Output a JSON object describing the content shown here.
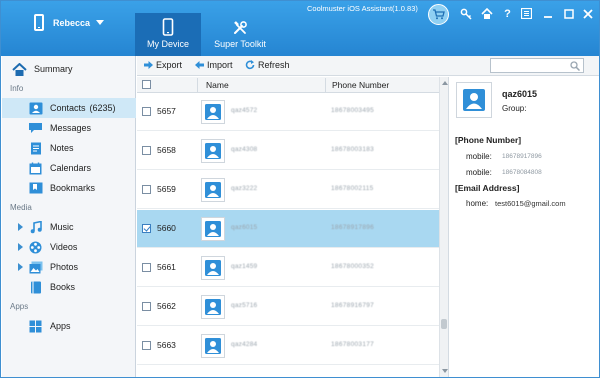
{
  "app": {
    "title": "Coolmuster iOS Assistant(1.0.83)",
    "device_name": "Rebecca"
  },
  "tabs": [
    {
      "label": "My Device"
    },
    {
      "label": "Super Toolkit"
    }
  ],
  "window_controls": {
    "key": "🔑",
    "home": "⌂",
    "help": "?",
    "menu": "▤",
    "minimize": "—",
    "close": "✕"
  },
  "sidebar": {
    "summary": "Summary",
    "section_info": "Info",
    "contacts": "Contacts",
    "contacts_count": "(6235)",
    "messages": "Messages",
    "notes": "Notes",
    "calendars": "Calendars",
    "bookmarks": "Bookmarks",
    "section_media": "Media",
    "music": "Music",
    "videos": "Videos",
    "photos": "Photos",
    "books": "Books",
    "section_apps": "Apps",
    "apps": "Apps"
  },
  "toolbar": {
    "export": "Export",
    "import": "Import",
    "refresh": "Refresh",
    "search_placeholder": ""
  },
  "table": {
    "columns": {
      "name": "Name",
      "phone": "Phone Number"
    },
    "rows": [
      {
        "id": "5657",
        "name": "qaz4572",
        "phone": "18678003495",
        "checked": false
      },
      {
        "id": "5658",
        "name": "qaz4308",
        "phone": "18678003183",
        "checked": false
      },
      {
        "id": "5659",
        "name": "qaz3222",
        "phone": "18678002115",
        "checked": false
      },
      {
        "id": "5660",
        "name": "qaz6015",
        "phone": "18678917896",
        "checked": true
      },
      {
        "id": "5661",
        "name": "qaz1459",
        "phone": "18678000352",
        "checked": false
      },
      {
        "id": "5662",
        "name": "qaz5716",
        "phone": "18678916797",
        "checked": false
      },
      {
        "id": "5663",
        "name": "qaz4284",
        "phone": "18678003177",
        "checked": false
      }
    ]
  },
  "detail": {
    "name": "qaz6015",
    "group_label": "Group:",
    "phone_section": "[Phone Number]",
    "phones": [
      {
        "label": "mobile:",
        "value": "18678917896"
      },
      {
        "label": "mobile:",
        "value": "18678084808"
      }
    ],
    "email_section": "[Email Address]",
    "email_label": "home:",
    "email_value": "test6015@gmail.com"
  },
  "colors": {
    "titlebar": "#2b8fdb",
    "active_tab": "#1b6db6",
    "selection": "#a9d8f1",
    "sidebar_selection": "#cfe8f7",
    "accent_icon": "#2f8fd8"
  }
}
